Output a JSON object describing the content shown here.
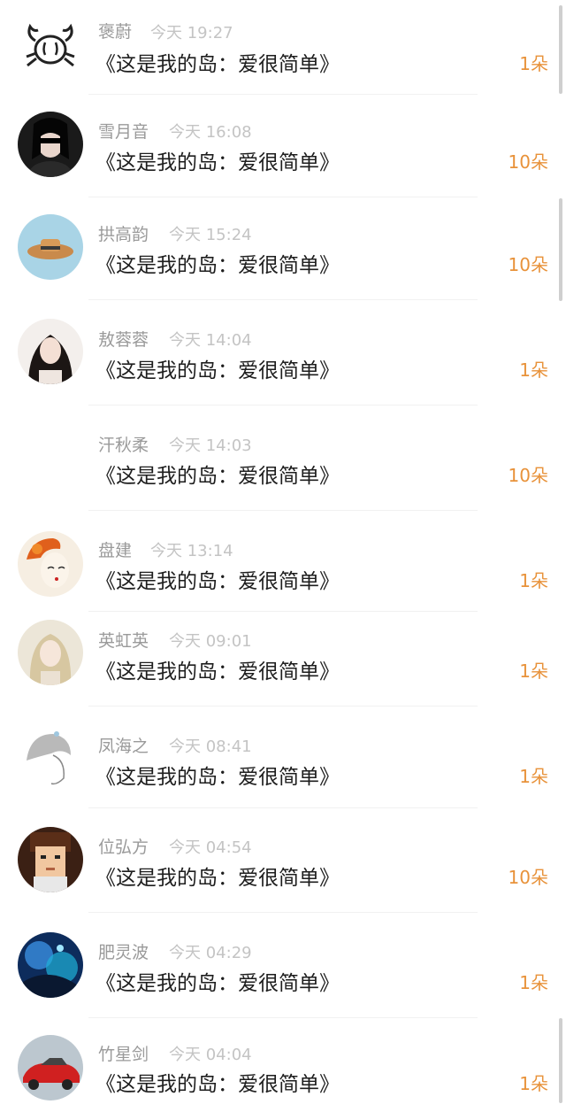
{
  "gift_list": [
    {
      "name": "褒蔚",
      "time": "今天 19:27",
      "title": "《这是我的岛：爱很简单》",
      "count": "1朵",
      "avatar": "crab"
    },
    {
      "name": "雪月音",
      "time": "今天 16:08",
      "title": "《这是我的岛：爱很简单》",
      "count": "10朵",
      "avatar": "dark-girl"
    },
    {
      "name": "拱高韵",
      "time": "今天 15:24",
      "title": "《这是我的岛：爱很简单》",
      "count": "10朵",
      "avatar": "hat"
    },
    {
      "name": "敖蓉蓉",
      "time": "今天 14:04",
      "title": "《这是我的岛：爱很简单》",
      "count": "1朵",
      "avatar": "girl-portrait"
    },
    {
      "name": "汗秋柔",
      "time": "今天 14:03",
      "title": "《这是我的岛：爱很简单》",
      "count": "10朵",
      "avatar": "none"
    },
    {
      "name": "盘建",
      "time": "今天 13:14",
      "title": "《这是我的岛：爱很简单》",
      "count": "1朵",
      "avatar": "opera-face"
    },
    {
      "name": "英虹英",
      "time": "今天 09:01",
      "title": "《这是我的岛：爱很简单》",
      "count": "1朵",
      "avatar": "blonde-girl"
    },
    {
      "name": "凤海之",
      "time": "今天 08:41",
      "title": "《这是我的岛：爱很简单》",
      "count": "1朵",
      "avatar": "sketch-girl"
    },
    {
      "name": "位弘方",
      "time": "今天 04:54",
      "title": "《这是我的岛：爱很简单》",
      "count": "10朵",
      "avatar": "pixel-boy"
    },
    {
      "name": "肥灵波",
      "time": "今天 04:29",
      "title": "《这是我的岛：爱很简单》",
      "count": "1朵",
      "avatar": "blue-fantasy"
    },
    {
      "name": "竹星剑",
      "time": "今天 04:04",
      "title": "《这是我的岛：爱很简单》",
      "count": "1朵",
      "avatar": "red-car"
    }
  ],
  "colors": {
    "count": "#e8923a",
    "name": "#9a9a9a",
    "time": "#c4c4c4",
    "title": "#1e1e1e"
  }
}
